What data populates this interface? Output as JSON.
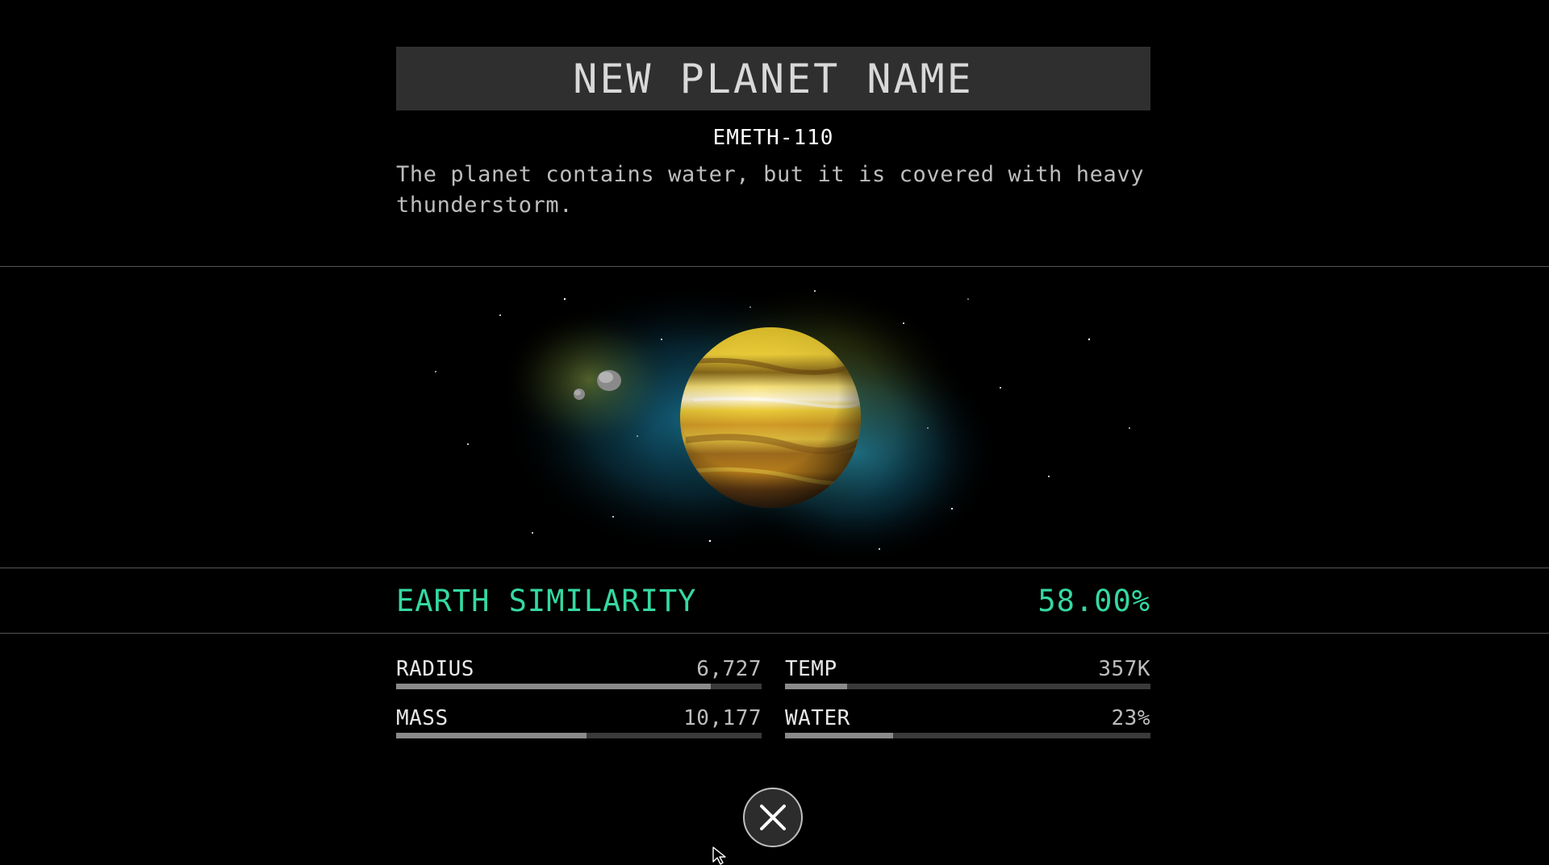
{
  "header": {
    "title": "NEW PLANET NAME",
    "planet_id": "EMETH-110",
    "description": "The planet contains water, but it is covered with heavy thunderstorm."
  },
  "similarity": {
    "label": "EARTH SIMILARITY",
    "value": "58.00%",
    "color": "#35d9a0"
  },
  "stats": {
    "radius": {
      "label": "RADIUS",
      "value": "6,727",
      "level": 0.86
    },
    "temp": {
      "label": "TEMP",
      "value": "357K",
      "level": 0.17
    },
    "mass": {
      "label": "MASS",
      "value": "10,177",
      "level": 0.52
    },
    "water": {
      "label": "WATER",
      "value": "23%",
      "level": 0.295
    }
  },
  "close_button": {
    "icon": "close-icon"
  },
  "scene": {
    "planet_colors": [
      "#f2d23a",
      "#c98a1e",
      "#5a3a1a"
    ],
    "nebula_colors": [
      "#1e8fb8",
      "#b8c23a"
    ]
  }
}
